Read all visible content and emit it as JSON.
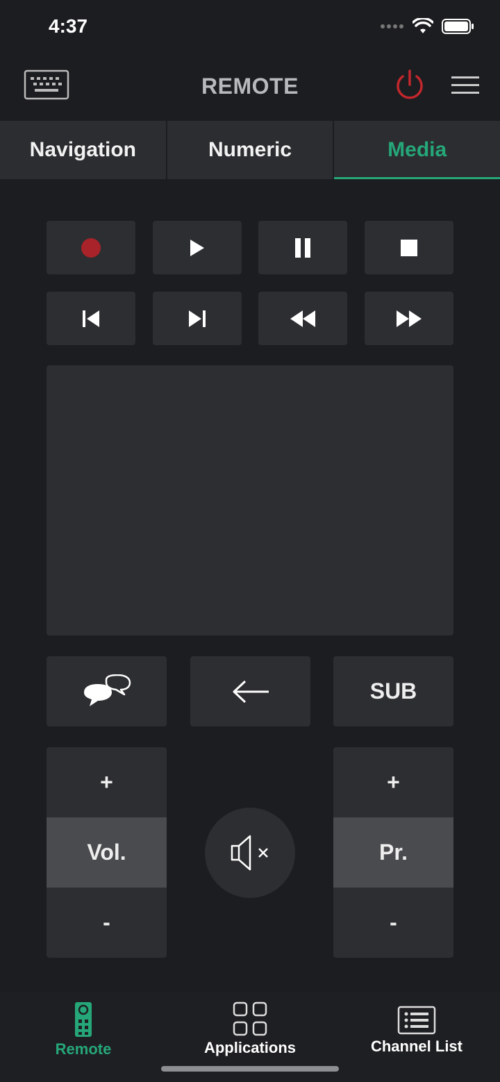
{
  "status": {
    "time": "4:37"
  },
  "header": {
    "title": "REMOTE"
  },
  "tabs": [
    {
      "label": "Navigation",
      "active": false
    },
    {
      "label": "Numeric",
      "active": false
    },
    {
      "label": "Media",
      "active": true
    }
  ],
  "media_buttons": [
    "record",
    "play",
    "pause",
    "stop",
    "skip-previous",
    "skip-next",
    "rewind",
    "fast-forward"
  ],
  "controls": {
    "subtitle_label": "SUB",
    "volume": {
      "plus": "+",
      "label": "Vol.",
      "minus": "-"
    },
    "program": {
      "plus": "+",
      "label": "Pr.",
      "minus": "-"
    }
  },
  "bottom_nav": [
    {
      "label": "Remote",
      "icon": "remote-icon",
      "active": true
    },
    {
      "label": "Applications",
      "icon": "grid-icon",
      "active": false
    },
    {
      "label": "Channel List",
      "icon": "list-icon",
      "active": false
    }
  ],
  "colors": {
    "accent": "#25a779",
    "power": "#c2272d",
    "record": "#a8232a",
    "background": "#1c1d20",
    "button": "#2d2e31"
  }
}
